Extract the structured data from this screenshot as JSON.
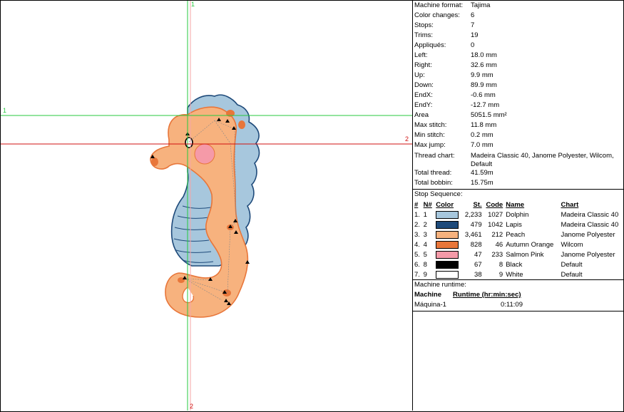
{
  "guides": {
    "v1": "1",
    "v2": "2",
    "h1": "1",
    "h2": "2"
  },
  "summary": [
    {
      "label": "Machine format:",
      "value": "Tajima"
    },
    {
      "label": "Color changes:",
      "value": "6"
    },
    {
      "label": "Stops:",
      "value": "7"
    },
    {
      "label": "Trims:",
      "value": "19"
    },
    {
      "label": "Appliqués:",
      "value": "0"
    },
    {
      "label": "Left:",
      "value": "18.0 mm"
    },
    {
      "label": "Right:",
      "value": "32.6 mm"
    },
    {
      "label": "Up:",
      "value": "9.9 mm"
    },
    {
      "label": "Down:",
      "value": "89.9 mm"
    },
    {
      "label": "EndX:",
      "value": "-0.6 mm"
    },
    {
      "label": "EndY:",
      "value": "-12.7 mm"
    },
    {
      "label": "Area",
      "value": "5051.5 mm²"
    },
    {
      "label": "Max stitch:",
      "value": "11.8 mm"
    },
    {
      "label": "Min stitch:",
      "value": "0.2 mm"
    },
    {
      "label": "Max jump:",
      "value": "7.0 mm"
    },
    {
      "label": "Thread chart:",
      "value": "Madeira Classic 40, Janome Polyester, Wilcom, Default"
    },
    {
      "label": "Total thread:",
      "value": "41.59m"
    },
    {
      "label": "Total bobbin:",
      "value": "15.75m"
    }
  ],
  "stop_sequence": {
    "title": "Stop Sequence:",
    "headers": {
      "num": "#",
      "n": "N#",
      "color": "Color",
      "st": "St.",
      "code": "Code",
      "name": "Name",
      "chart": "Chart"
    },
    "rows": [
      {
        "num": "1.",
        "n": "1",
        "color": "#a7c7dd",
        "st": "2,233",
        "code": "1027",
        "name": "Dolphin",
        "chart": "Madeira Classic 40"
      },
      {
        "num": "2.",
        "n": "2",
        "color": "#1e4a7a",
        "st": "479",
        "code": "1042",
        "name": "Lapis",
        "chart": "Madeira Classic 40"
      },
      {
        "num": "3.",
        "n": "3",
        "color": "#f7b27e",
        "st": "3,461",
        "code": "212",
        "name": "Peach",
        "chart": "Janome Polyester"
      },
      {
        "num": "4.",
        "n": "4",
        "color": "#e8763a",
        "st": "828",
        "code": "46",
        "name": "Autumn Orange",
        "chart": "Wilcom"
      },
      {
        "num": "5.",
        "n": "5",
        "color": "#f59aa8",
        "st": "47",
        "code": "233",
        "name": "Salmon Pink",
        "chart": "Janome Polyester"
      },
      {
        "num": "6.",
        "n": "8",
        "color": "#000000",
        "st": "67",
        "code": "8",
        "name": "Black",
        "chart": "Default"
      },
      {
        "num": "7.",
        "n": "9",
        "color": "#ffffff",
        "st": "38",
        "code": "9",
        "name": "White",
        "chart": "Default"
      }
    ]
  },
  "runtime": {
    "title": "Machine runtime:",
    "col_machine": "Machine",
    "col_runtime": "Runtime (hr:min:sec)",
    "machine": "Máquina-1",
    "time": "0:11:09"
  }
}
